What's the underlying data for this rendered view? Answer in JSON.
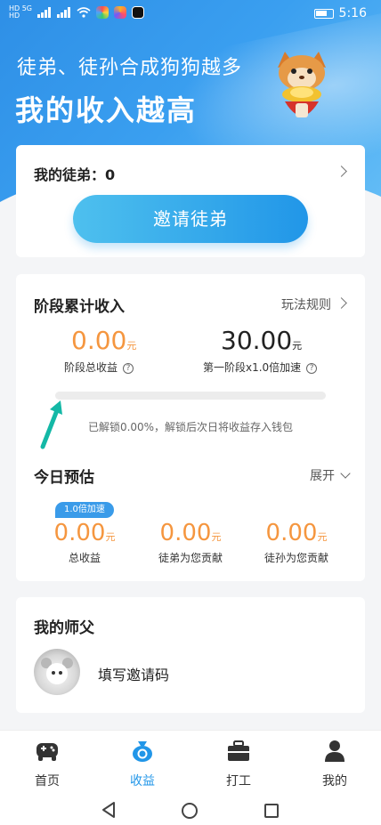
{
  "status_bar": {
    "network_left_top": "HD 5G",
    "network_left_bottom": "HD",
    "time": "5:16"
  },
  "hero": {
    "subtitle": "徒弟、徒孙合成狗狗越多",
    "title": "我的收入越高"
  },
  "apprentices": {
    "label": "我的徒弟：0",
    "invite_button": "邀请徒弟"
  },
  "stage_income": {
    "title": "阶段累计收入",
    "rules_link": "玩法规则",
    "total_value": "0.00",
    "total_unit": "元",
    "total_label": "阶段总收益",
    "target_value": "30.00",
    "target_unit": "元",
    "target_label": "第一阶段x1.0倍加速",
    "progress_fraction": 0.0,
    "unlock_note": "已解锁0.00%，解锁后次日将收益存入钱包"
  },
  "today_estimate": {
    "title": "今日预估",
    "expand_label": "展开",
    "speed_badge": "1.0倍加速",
    "columns": [
      {
        "value": "0.00",
        "unit": "元",
        "caption": "总收益"
      },
      {
        "value": "0.00",
        "unit": "元",
        "caption": "徒弟为您贡献"
      },
      {
        "value": "0.00",
        "unit": "元",
        "caption": "徒孙为您贡献"
      }
    ]
  },
  "master": {
    "title": "我的师父",
    "fill_code": "填写邀请码"
  },
  "tab_bar": {
    "active": "收益",
    "items": [
      {
        "label": "首页",
        "icon": "gamepad-icon"
      },
      {
        "label": "收益",
        "icon": "money-bag-icon"
      },
      {
        "label": "打工",
        "icon": "briefcase-icon"
      },
      {
        "label": "我的",
        "icon": "person-icon"
      }
    ]
  },
  "colors": {
    "primary": "#2196e8",
    "accent_orange": "#f5963f"
  }
}
